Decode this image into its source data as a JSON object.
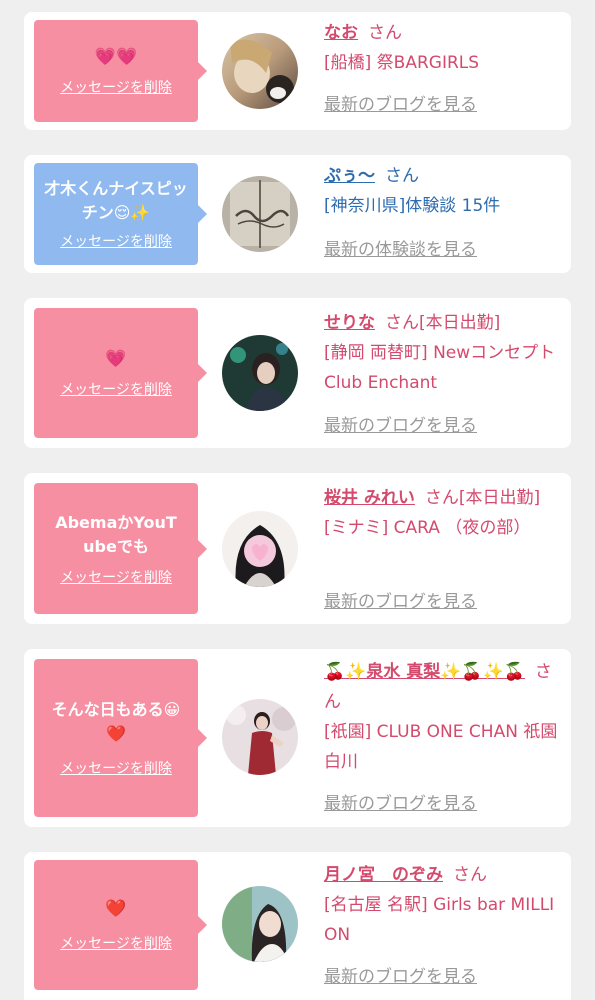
{
  "cards": [
    {
      "message_text": "",
      "message_emoji": "💗💗",
      "delete_label": "メッセージを削除",
      "name": "なお",
      "honorific": "さん",
      "status": "",
      "shop": "[船橋] 祭BARGIRLS",
      "latest_link": "最新のブログを見る",
      "avatar": "photo-avatar"
    },
    {
      "message_text": "才木くんナイスピッチン😌✨",
      "message_emoji": "",
      "delete_label": "メッセージを削除",
      "name": "ぷぅ〜",
      "honorific": "さん",
      "status": "",
      "shop": "[神奈川県]体験談 15件",
      "latest_link": "最新の体験談を見る",
      "avatar": "photo-avatar"
    },
    {
      "message_text": "",
      "message_emoji": "💗",
      "delete_label": "メッセージを削除",
      "name": "せりな",
      "honorific": "さん",
      "status": "[本日出勤]",
      "shop": "[静岡 両替町] Newコンセプト Club Enchant",
      "latest_link": "最新のブログを見る",
      "avatar": "photo-avatar"
    },
    {
      "message_text": "AbemaかYouTubeでも",
      "message_emoji": "",
      "delete_label": "メッセージを削除",
      "name": "桜井 みれい",
      "honorific": "さん",
      "status": "[本日出勤]",
      "shop": "[ミナミ] CARA （夜の部）",
      "latest_link": "最新のブログを見る",
      "avatar": "photo-avatar"
    },
    {
      "message_text": "そんな日もある😀❤️",
      "message_emoji": "",
      "delete_label": "メッセージを削除",
      "name": "🍒✨泉水 真梨✨🍒✨🍒",
      "honorific": "さん",
      "status": "",
      "shop": "[祇園] CLUB ONE CHAN 祇園白川",
      "latest_link": "最新のブログを見る",
      "avatar": "photo-avatar"
    },
    {
      "message_text": "",
      "message_emoji": "❤️",
      "delete_label": "メッセージを削除",
      "name": "月ノ宮　のぞみ",
      "honorific": "さん",
      "status": "",
      "shop": "[名古屋 名駅] Girls bar MILLION",
      "latest_link": "最新のブログを見る",
      "avatar": "photo-avatar"
    }
  ],
  "colors": {
    "background": "#efeff0",
    "card": "#ffffff",
    "bubble_pink": "#f78fa3",
    "bubble_blue": "#8fb9ef",
    "name_pink": "#d44a6d",
    "name_blue": "#2e6cb0",
    "link_gray": "#999999"
  }
}
